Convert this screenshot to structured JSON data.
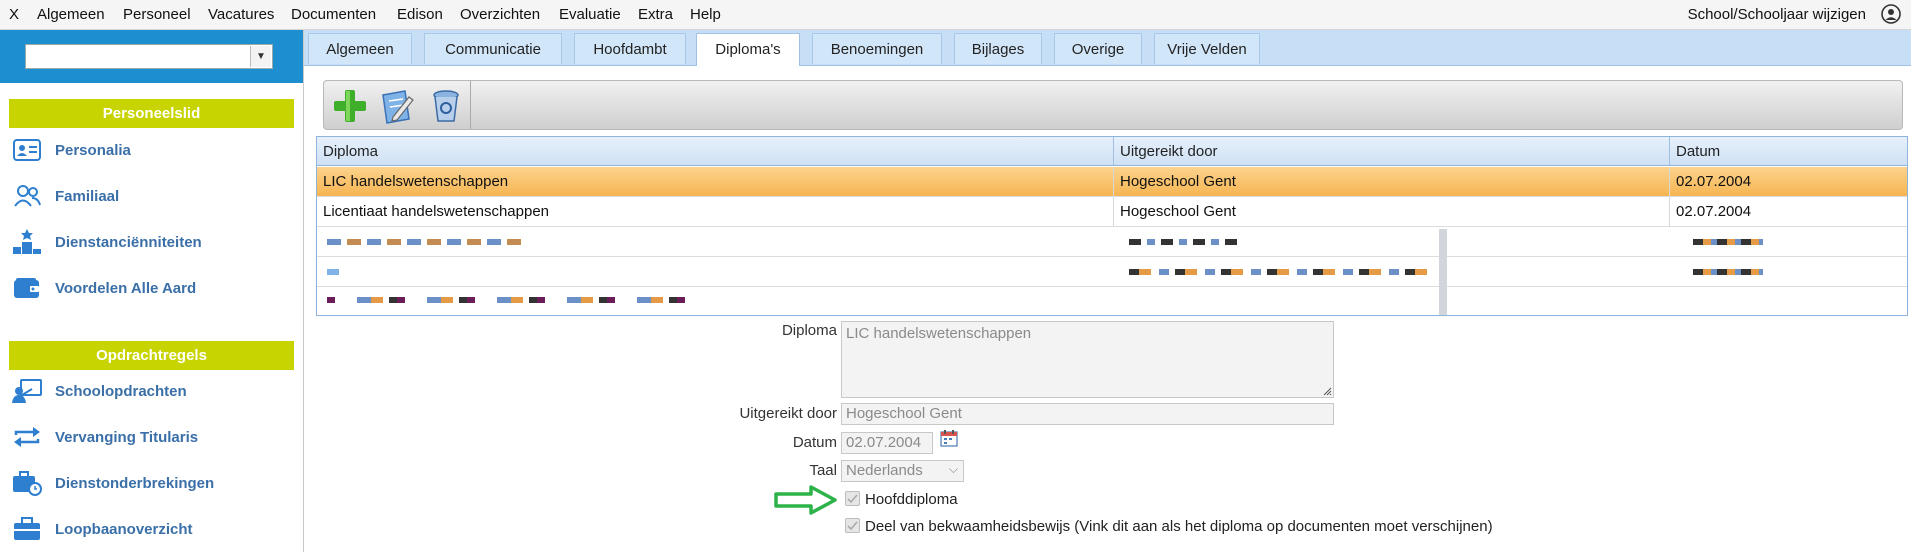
{
  "menu": {
    "close": "X",
    "items": [
      "Algemeen",
      "Personeel",
      "Vacatures",
      "Documenten",
      "Edison",
      "Overzichten",
      "Evaluatie",
      "Extra",
      "Help"
    ],
    "school_link": "School/Schooljaar wijzigen"
  },
  "sidebar": {
    "section1": "Personeelslid",
    "items1": [
      "Personalia",
      "Familiaal",
      "Dienstanciënniteiten",
      "Voordelen Alle Aard"
    ],
    "section2": "Opdrachtregels",
    "items2": [
      "Schoolopdrachten",
      "Vervanging Titularis",
      "Dienstonderbrekingen",
      "Loopbaanoverzicht"
    ]
  },
  "tabs": [
    "Algemeen",
    "Communicatie",
    "Hoofdambt",
    "Diploma's",
    "Benoemingen",
    "Bijlages",
    "Overige",
    "Vrije Velden"
  ],
  "active_tab": "Diploma's",
  "grid": {
    "headers": [
      "Diploma",
      "Uitgereikt door",
      "Datum"
    ],
    "rows": [
      {
        "diploma": "LIC handelswetenschappen",
        "uitgereikt": "Hogeschool Gent",
        "datum": "02.07.2004"
      },
      {
        "diploma": "Licentiaat handelswetenschappen",
        "uitgereikt": "Hogeschool Gent",
        "datum": "02.07.2004"
      }
    ]
  },
  "form": {
    "diploma_label": "Diploma",
    "diploma_value": "LIC handelswetenschappen",
    "uitgereikt_label": "Uitgereikt door",
    "uitgereikt_value": "Hogeschool Gent",
    "datum_label": "Datum",
    "datum_value": "02.07.2004",
    "taal_label": "Taal",
    "taal_value": "Nederlands",
    "hoofddiploma_label": "Hoofddiploma",
    "bekwaamheid_label": "Deel van bekwaamheidsbewijs (Vink dit aan als het diploma op documenten moet verschijnen)"
  },
  "colors": {
    "accent_blue": "#1d8fd0",
    "section_green": "#c8d400",
    "selected_row": "#f8bf62",
    "arrow_green": "#2db34a"
  }
}
